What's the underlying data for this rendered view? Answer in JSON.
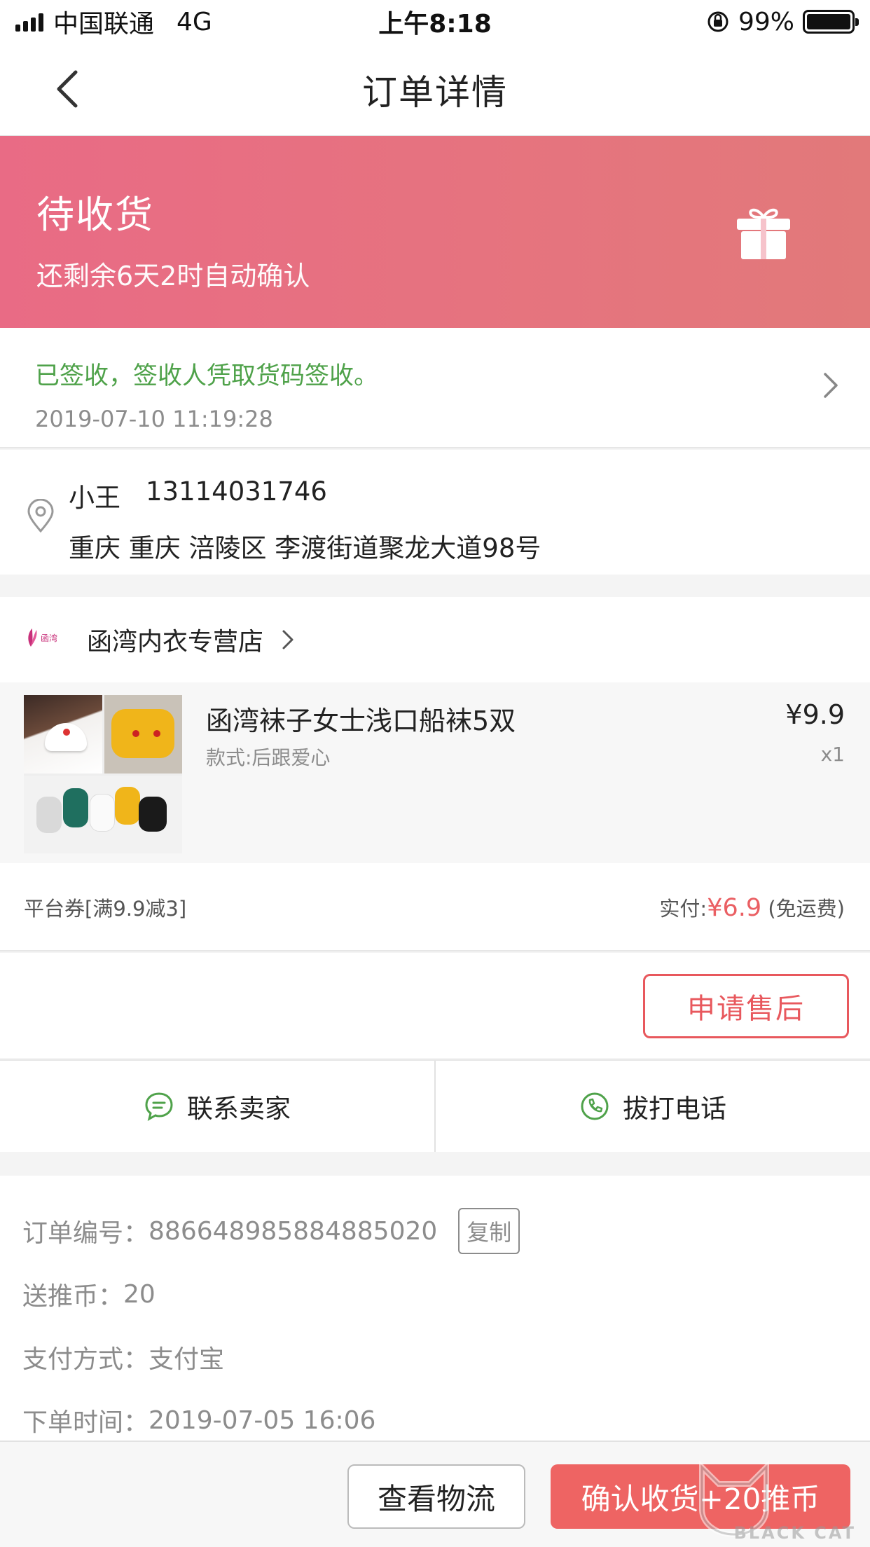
{
  "status_bar": {
    "carrier": "中国联通",
    "network": "4G",
    "time": "上午8:18",
    "battery": "99%"
  },
  "nav": {
    "title": "订单详情",
    "back_icon": "chevron-left-icon"
  },
  "order_status": {
    "title": "待收货",
    "subtitle": "还剩余6天2时自动确认",
    "icon": "gift-icon",
    "gradient": [
      "#e96b85",
      "#e2797a"
    ]
  },
  "logistics": {
    "message": "已签收，签收人凭取货码签收。",
    "time": "2019-07-10 11:19:28"
  },
  "address": {
    "name": "小王",
    "phone": "13114031746",
    "detail": "重庆 重庆 涪陵区 李渡街道聚龙大道98号"
  },
  "shop": {
    "name": "函湾内衣专营店",
    "logo_text": "函湾"
  },
  "product": {
    "name": "函湾袜子女士浅口船袜5双",
    "spec": "款式:后跟爱心",
    "price": "¥9.9",
    "quantity": "x1"
  },
  "summary": {
    "coupon": "平台券[满9.9减3]",
    "paid_label": "实付:",
    "paid_amount": "¥6.9",
    "shipping": " (免运费)"
  },
  "after_sale_button": "申请售后",
  "contact": {
    "seller": "联系卖家",
    "call": "拔打电话"
  },
  "order_info": {
    "order_no_label": "订单编号：",
    "order_no": "886648985884885020",
    "copy_label": "复制",
    "coins_label": "送推币：",
    "coins": "20",
    "payment_label": "支付方式：",
    "payment": "支付宝",
    "time_label": "下单时间：",
    "time": "2019-07-05 16:06"
  },
  "bottom_bar": {
    "logistics_button": "查看物流",
    "confirm_button": "确认收货+20推币"
  },
  "watermark": {
    "text": "BLACK CAT"
  },
  "colors": {
    "accent_red": "#ea5f63",
    "success_green": "#4fa24a",
    "banner_pink": "#e96b85"
  }
}
